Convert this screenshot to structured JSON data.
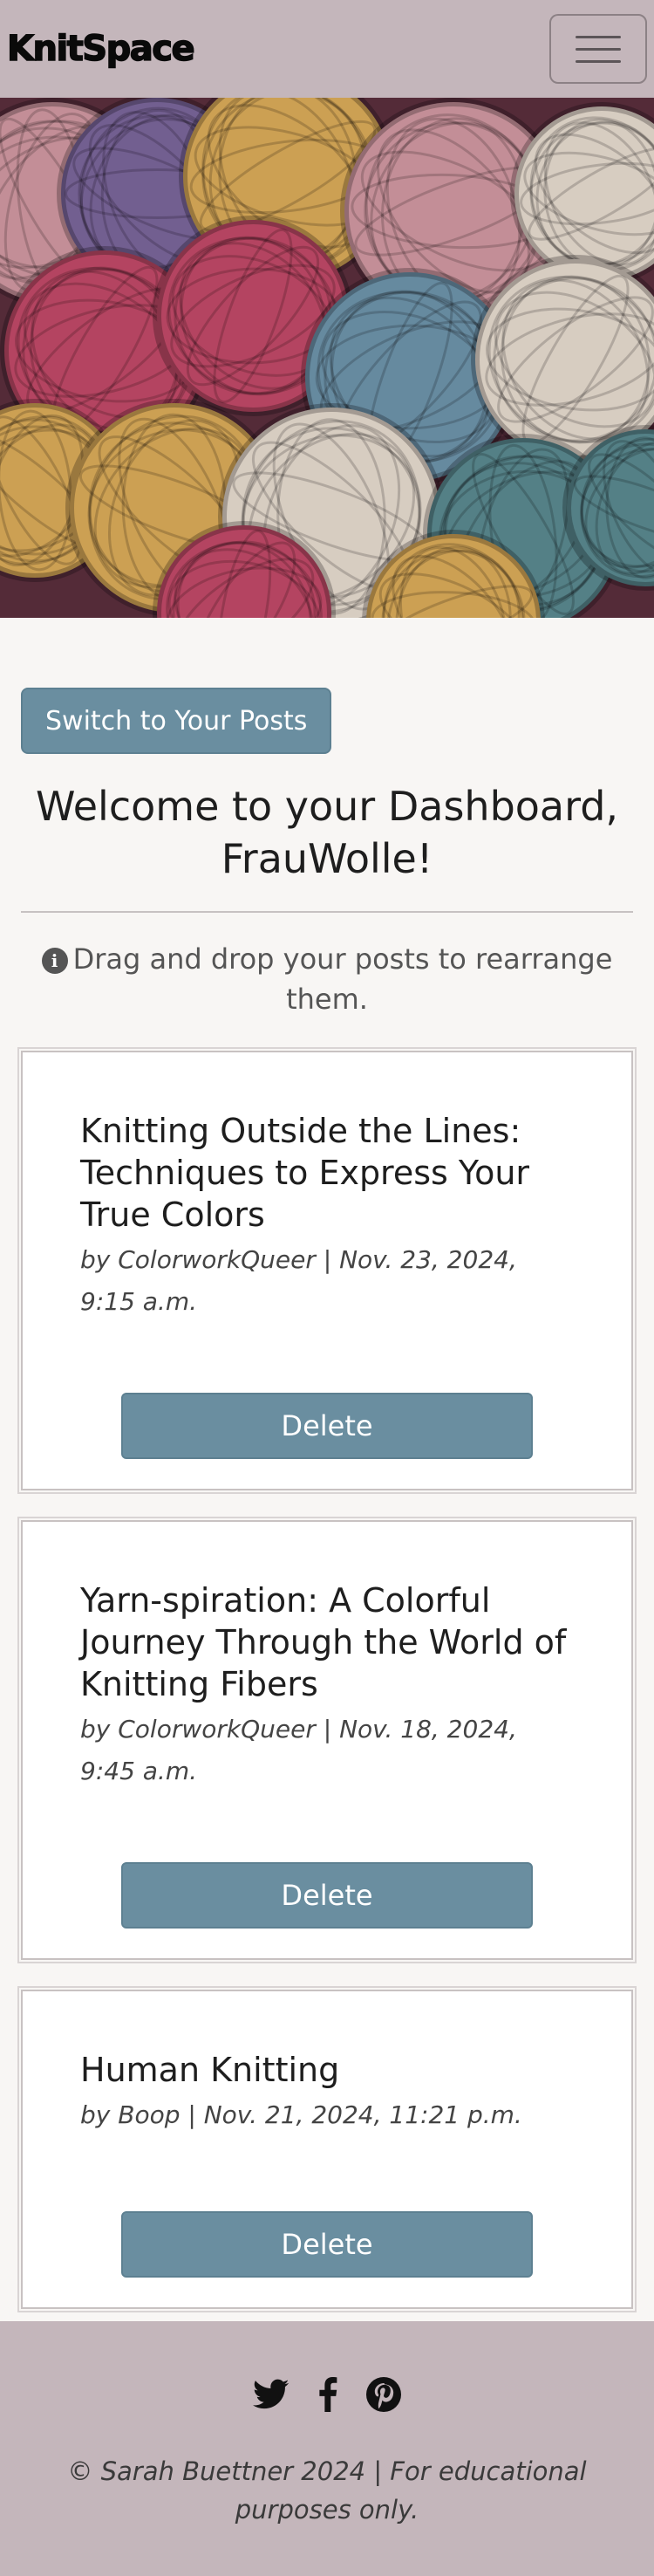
{
  "navbar": {
    "brand": "KnitSpace",
    "toggler_icon": "hamburger-icon"
  },
  "hero": {
    "image_subject": "balls of colorful yarn",
    "colors": [
      "#c84c6a",
      "#e3b45a",
      "#6f9bb1",
      "#f0e8d8",
      "#7d6aa0",
      "#d9a0a8",
      "#5a9094"
    ]
  },
  "main": {
    "switch_button_label": "Switch to Your Posts",
    "welcome_heading": "Welcome to your Dashboard, FrauWolle!",
    "hint_icon": "info-circle-icon",
    "hint_text": "Drag and drop your posts to rearrange them."
  },
  "posts": [
    {
      "title": "Knitting Outside the Lines: Techniques to Express Your True Colors",
      "meta": "by ColorworkQueer | Nov. 23, 2024, 9:15 a.m.",
      "delete_label": "Delete"
    },
    {
      "title": "Yarn-spiration: A Colorful Journey Through the World of Knitting Fibers",
      "meta": "by ColorworkQueer | Nov. 18, 2024, 9:45 a.m.",
      "delete_label": "Delete"
    },
    {
      "title": "Human Knitting",
      "meta": "by Boop | Nov. 21, 2024, 11:21 p.m.",
      "delete_label": "Delete"
    }
  ],
  "footer": {
    "social_icons": [
      "twitter-icon",
      "facebook-icon",
      "pinterest-icon"
    ],
    "copyright": "© Sarah Buettner 2024 | For educational purposes only."
  },
  "colors": {
    "navbar_bg": "#c4b6bb",
    "button_bg": "#6a8ea0",
    "page_bg": "#f8f6f4"
  }
}
